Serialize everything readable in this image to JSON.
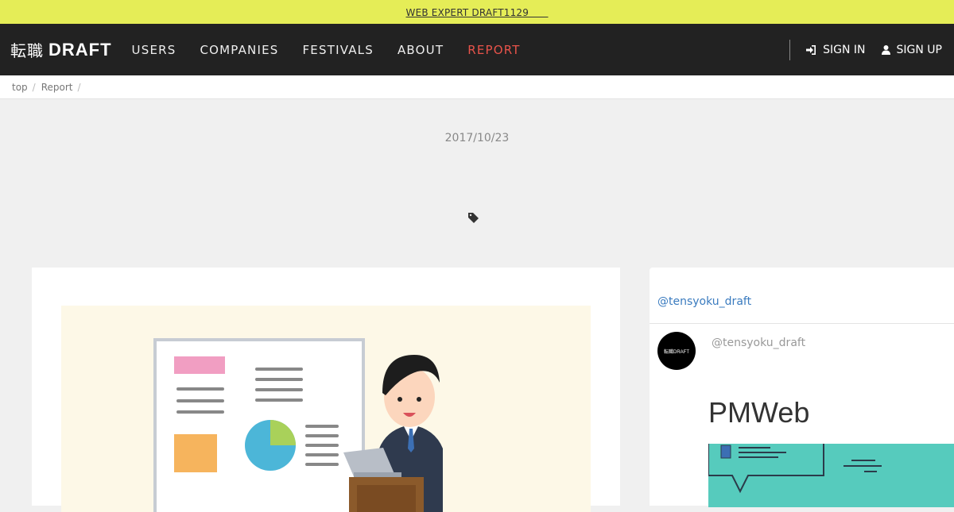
{
  "banner": {
    "text": "WEB EXPERT DRAFT1129　　"
  },
  "brand": {
    "jp": "転職",
    "en": "DRAFT"
  },
  "nav": {
    "items": [
      {
        "label": "USERS"
      },
      {
        "label": "COMPANIES"
      },
      {
        "label": "FESTIVALS"
      },
      {
        "label": "ABOUT"
      },
      {
        "label": "REPORT",
        "active": true
      }
    ],
    "sign_in": "SIGN IN",
    "sign_up": "SIGN UP"
  },
  "breadcrumb": {
    "items": [
      "top",
      "Report"
    ]
  },
  "article": {
    "date": "2017/10/23"
  },
  "sidebar": {
    "handle_link": "@tensyoku_draft",
    "tweet_handle": "@tensyoku_draft",
    "avatar_text": "転職DRAFT",
    "tweet_title": "PMWeb"
  },
  "colors": {
    "banner": "#e5ed57",
    "navbar": "#222222",
    "active_nav": "#e8534a",
    "link": "#3a7bbf",
    "page_bg": "#f0f0f0",
    "eyecatch_bg": "#fdf8e7",
    "tweet_image": "#56cbbd"
  },
  "icons": [
    "sign-in-icon",
    "user-icon",
    "tag-icon"
  ]
}
